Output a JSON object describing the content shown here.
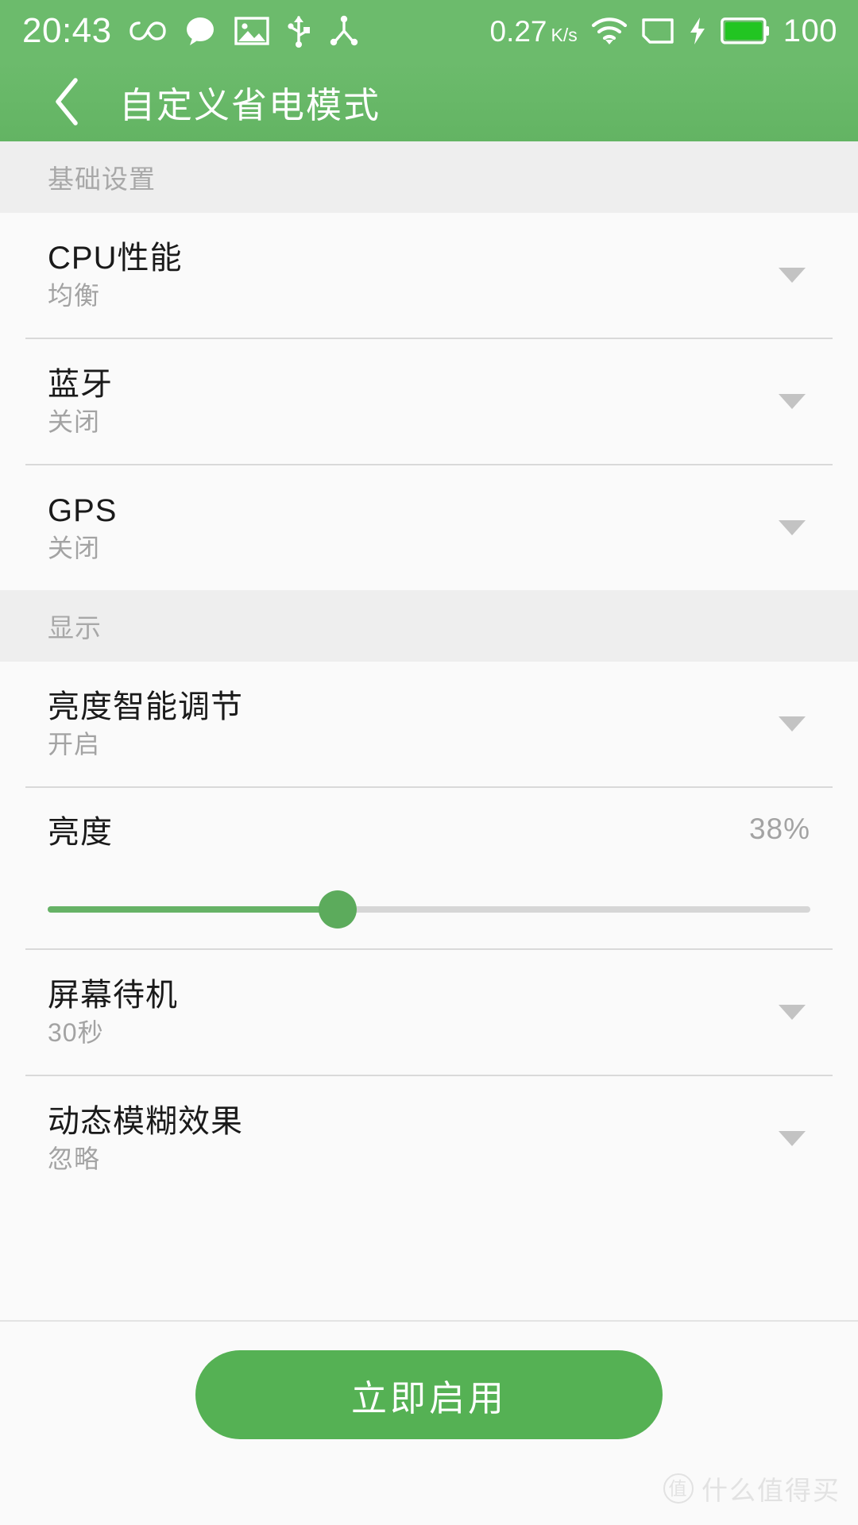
{
  "status_bar": {
    "time": "20:43",
    "network_rate": "0.27",
    "network_rate_unit": "K/s",
    "battery_percent": "100",
    "icons": [
      "infinity-icon",
      "message-bubble-icon",
      "image-icon",
      "usb-icon",
      "tethering-icon",
      "wifi-icon",
      "sim-card-icon",
      "charging-bolt-icon",
      "battery-icon"
    ]
  },
  "header": {
    "back_label": "返回",
    "title": "自定义省电模式"
  },
  "sections": [
    {
      "title": "基础设置",
      "rows": [
        {
          "label": "CPU性能",
          "value": "均衡",
          "control": "dropdown"
        },
        {
          "label": "蓝牙",
          "value": "关闭",
          "control": "dropdown"
        },
        {
          "label": "GPS",
          "value": "关闭",
          "control": "dropdown"
        }
      ]
    },
    {
      "title": "显示",
      "rows": [
        {
          "label": "亮度智能调节",
          "value": "开启",
          "control": "dropdown"
        },
        {
          "label": "亮度",
          "value": "38%",
          "control": "slider",
          "slider_percent": 38
        },
        {
          "label": "屏幕待机",
          "value": "30秒",
          "control": "dropdown"
        },
        {
          "label": "动态模糊效果",
          "value": "忽略",
          "control": "dropdown"
        }
      ]
    }
  ],
  "footer": {
    "primary_button": "立即启用",
    "watermark_badge": "值",
    "watermark_text": "什么值得买"
  },
  "colors": {
    "accent_green": "#6cbb6c",
    "button_green": "#55b154",
    "slider_green": "#66b266",
    "battery_green": "#22c522",
    "section_bg": "#eeeeee",
    "page_bg": "#fafafa",
    "title_text": "#1a1a1a",
    "value_text": "#a3a3a3"
  }
}
